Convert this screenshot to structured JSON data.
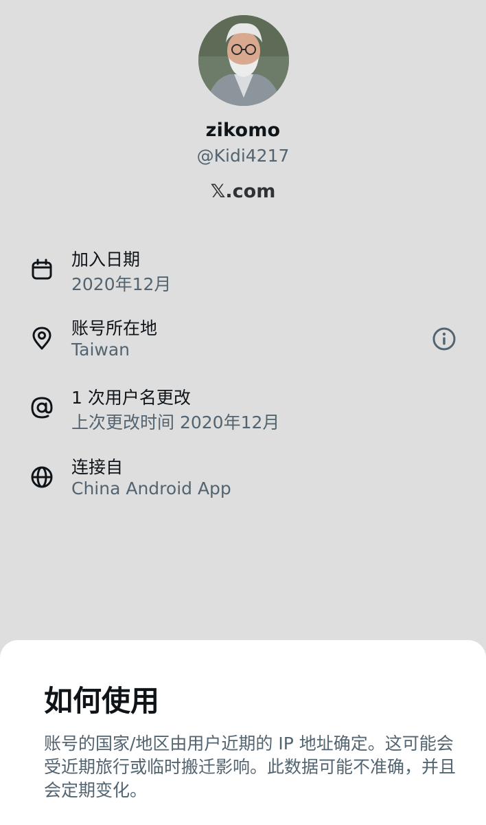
{
  "profile": {
    "display_name": "zikomo",
    "handle": "@Kidi4217",
    "site": "𝕏.com",
    "avatar_icon": "user-avatar-photo"
  },
  "rows": [
    {
      "icon": "calendar-icon",
      "title": "加入日期",
      "subtitle": "2020年12月"
    },
    {
      "icon": "location-pin-icon",
      "title": "账号所在地",
      "subtitle": "Taiwan"
    },
    {
      "icon": "at-sign-icon",
      "title": "1 次用户名更改",
      "subtitle": "上次更改时间 2020年12月"
    },
    {
      "icon": "globe-icon",
      "title": "连接自",
      "subtitle": "China Android App"
    }
  ],
  "info_icon": "info-circle-icon",
  "sheet": {
    "title": "如何使用",
    "body": "账号的国家/地区由用户近期的 IP 地址确定。这可能会受近期旅行或临时搬迁影响。此数据可能不准确，并且会定期变化。"
  },
  "colors": {
    "background": "#dedede",
    "primary_text": "#0f1419",
    "secondary_text": "#536471",
    "sheet_background": "#ffffff"
  }
}
